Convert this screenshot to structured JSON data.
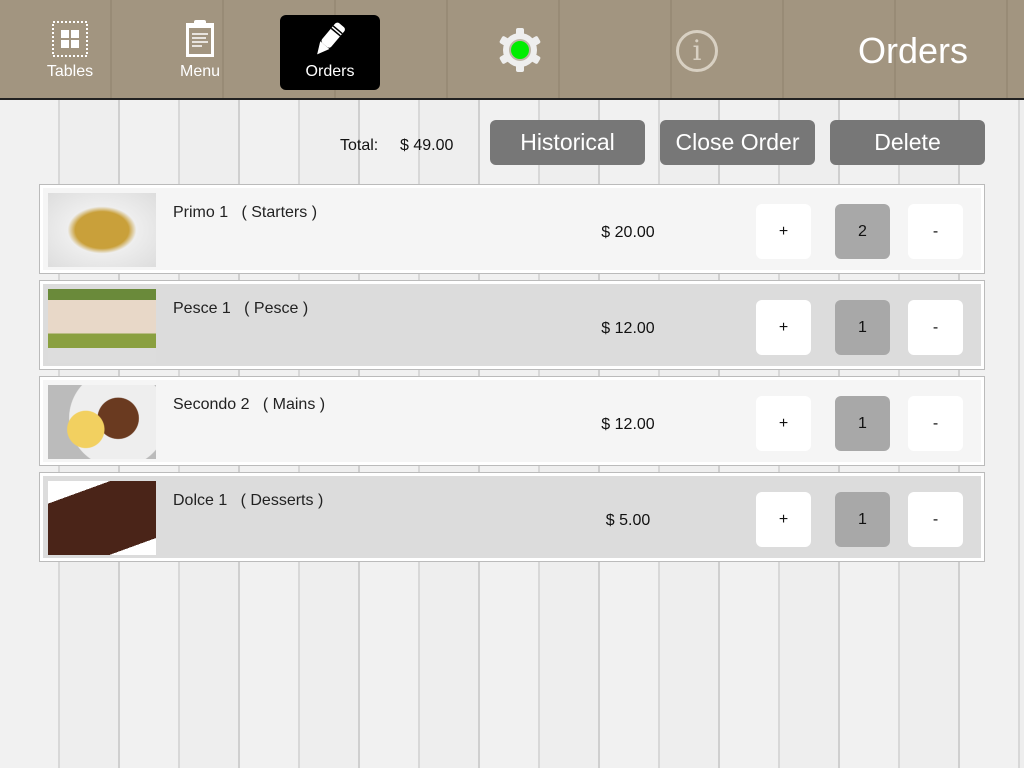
{
  "nav": {
    "tables": "Tables",
    "menu": "Menu",
    "orders": "Orders",
    "title": "Orders",
    "status_color": "#00ee00"
  },
  "summary": {
    "total_label": "Total:",
    "total_value": "$ 49.00"
  },
  "actions": {
    "historical": "Historical",
    "close_order": "Close Order",
    "delete": "Delete"
  },
  "items": [
    {
      "name": "Primo 1",
      "category": "( Starters )",
      "price": "$ 20.00",
      "qty": "2",
      "plus": "+",
      "minus": "-"
    },
    {
      "name": "Pesce 1",
      "category": "( Pesce )",
      "price": "$ 12.00",
      "qty": "1",
      "plus": "+",
      "minus": "-"
    },
    {
      "name": "Secondo 2",
      "category": "( Mains )",
      "price": "$ 12.00",
      "qty": "1",
      "plus": "+",
      "minus": "-"
    },
    {
      "name": "Dolce 1",
      "category": "( Desserts )",
      "price": "$ 5.00",
      "qty": "1",
      "plus": "+",
      "minus": "-"
    }
  ]
}
